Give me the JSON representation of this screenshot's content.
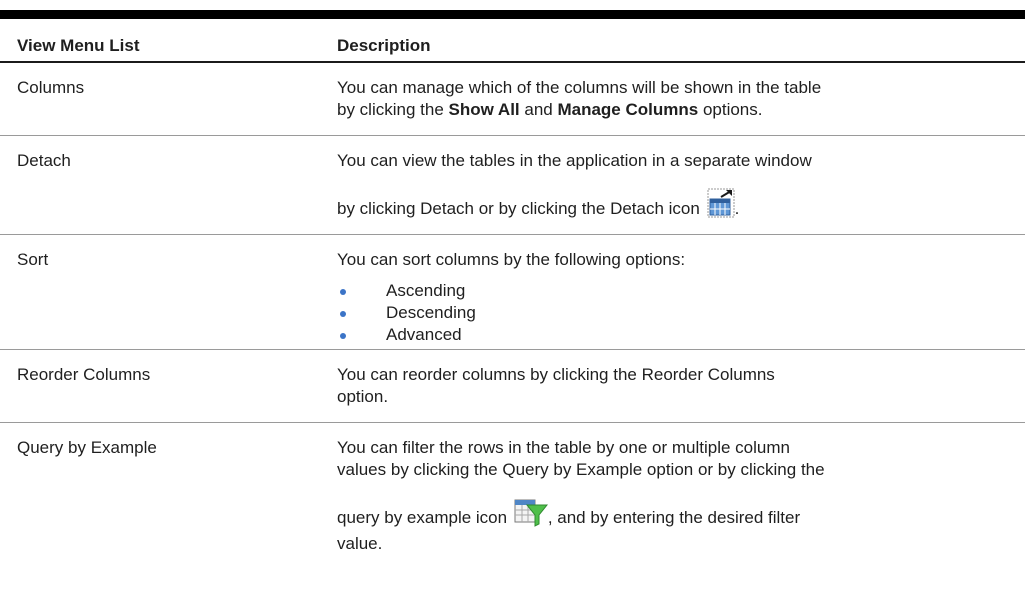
{
  "table": {
    "headers": {
      "col1": "View Menu List",
      "col2": "Description"
    },
    "rows": {
      "columns": {
        "name": "Columns",
        "desc_line1": "You can manage which of the columns will be shown in the table",
        "desc_prefix": "by clicking the ",
        "desc_bold1": "Show All",
        "desc_mid": " and ",
        "desc_bold2": "Manage Columns",
        "desc_suffix": " options."
      },
      "detach": {
        "name": "Detach",
        "desc_line1": "You can view the tables in the application in a separate window",
        "desc_line2": "by clicking Detach or by clicking the Detach icon",
        "desc_end": ".",
        "icon": "detach-icon"
      },
      "sort": {
        "name": "Sort",
        "desc_line1": "You can sort columns by the following options:",
        "options": [
          "Ascending",
          "Descending",
          "Advanced"
        ]
      },
      "reorder": {
        "name": "Reorder Columns",
        "desc_line1": "You can reorder columns by clicking the Reorder Columns",
        "desc_line2": "option."
      },
      "query": {
        "name": "Query by Example",
        "desc_line1": "You can filter the rows in the table by one or multiple column",
        "desc_line2": "values by clicking the Query by Example option or by clicking the",
        "desc_line3_prefix": "query by example icon",
        "desc_line3_suffix": ", and by entering the desired filter",
        "desc_line4": "value.",
        "icon": "query-by-example-icon"
      }
    }
  },
  "colors": {
    "text": "#1f1f1f",
    "bullet": "#3b74c7",
    "rule": "#000000"
  }
}
